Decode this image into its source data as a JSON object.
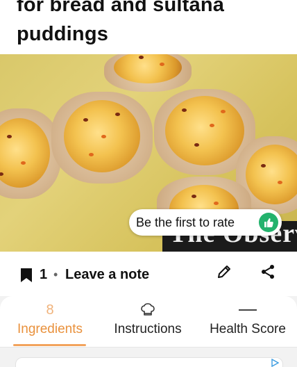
{
  "recipe": {
    "title": "for bread and sultana puddings"
  },
  "photo": {
    "watermark": "The Observer"
  },
  "rating": {
    "prompt": "Be the first to rate",
    "button_color": "#23b26d"
  },
  "actions": {
    "bookmark_count": "1",
    "separator": "•",
    "note_label": "Leave a note"
  },
  "tabs": [
    {
      "top": "8",
      "label": "Ingredients",
      "active": true
    },
    {
      "top": "chef-hat-icon",
      "label": "Instructions",
      "active": false
    },
    {
      "top": "dash-icon",
      "label": "Health Score",
      "active": false
    }
  ],
  "colors": {
    "accent": "#e9913c",
    "accent_light": "#f0b27a"
  }
}
